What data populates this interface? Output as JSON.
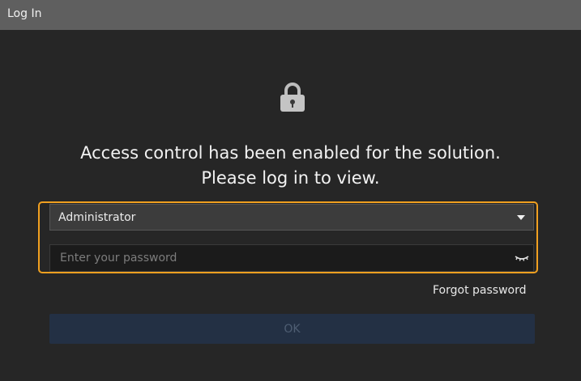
{
  "window": {
    "title": "Log In"
  },
  "lock_icon": "lock-icon",
  "message": {
    "line1": "Access control has been enabled for the solution.",
    "line2": "Please log in to view."
  },
  "user_select": {
    "selected": "Administrator",
    "icon": "chevron-down-icon"
  },
  "password": {
    "value": "",
    "placeholder": "Enter your password",
    "toggle_icon": "eye-closed-icon"
  },
  "forgot_label": "Forgot password",
  "ok_label": "OK",
  "colors": {
    "background": "#262626",
    "titlebar": "#5f5f5f",
    "focus_outline": "#f0a020",
    "ok_disabled_bg": "#233044",
    "ok_disabled_text": "#4f5e73"
  }
}
